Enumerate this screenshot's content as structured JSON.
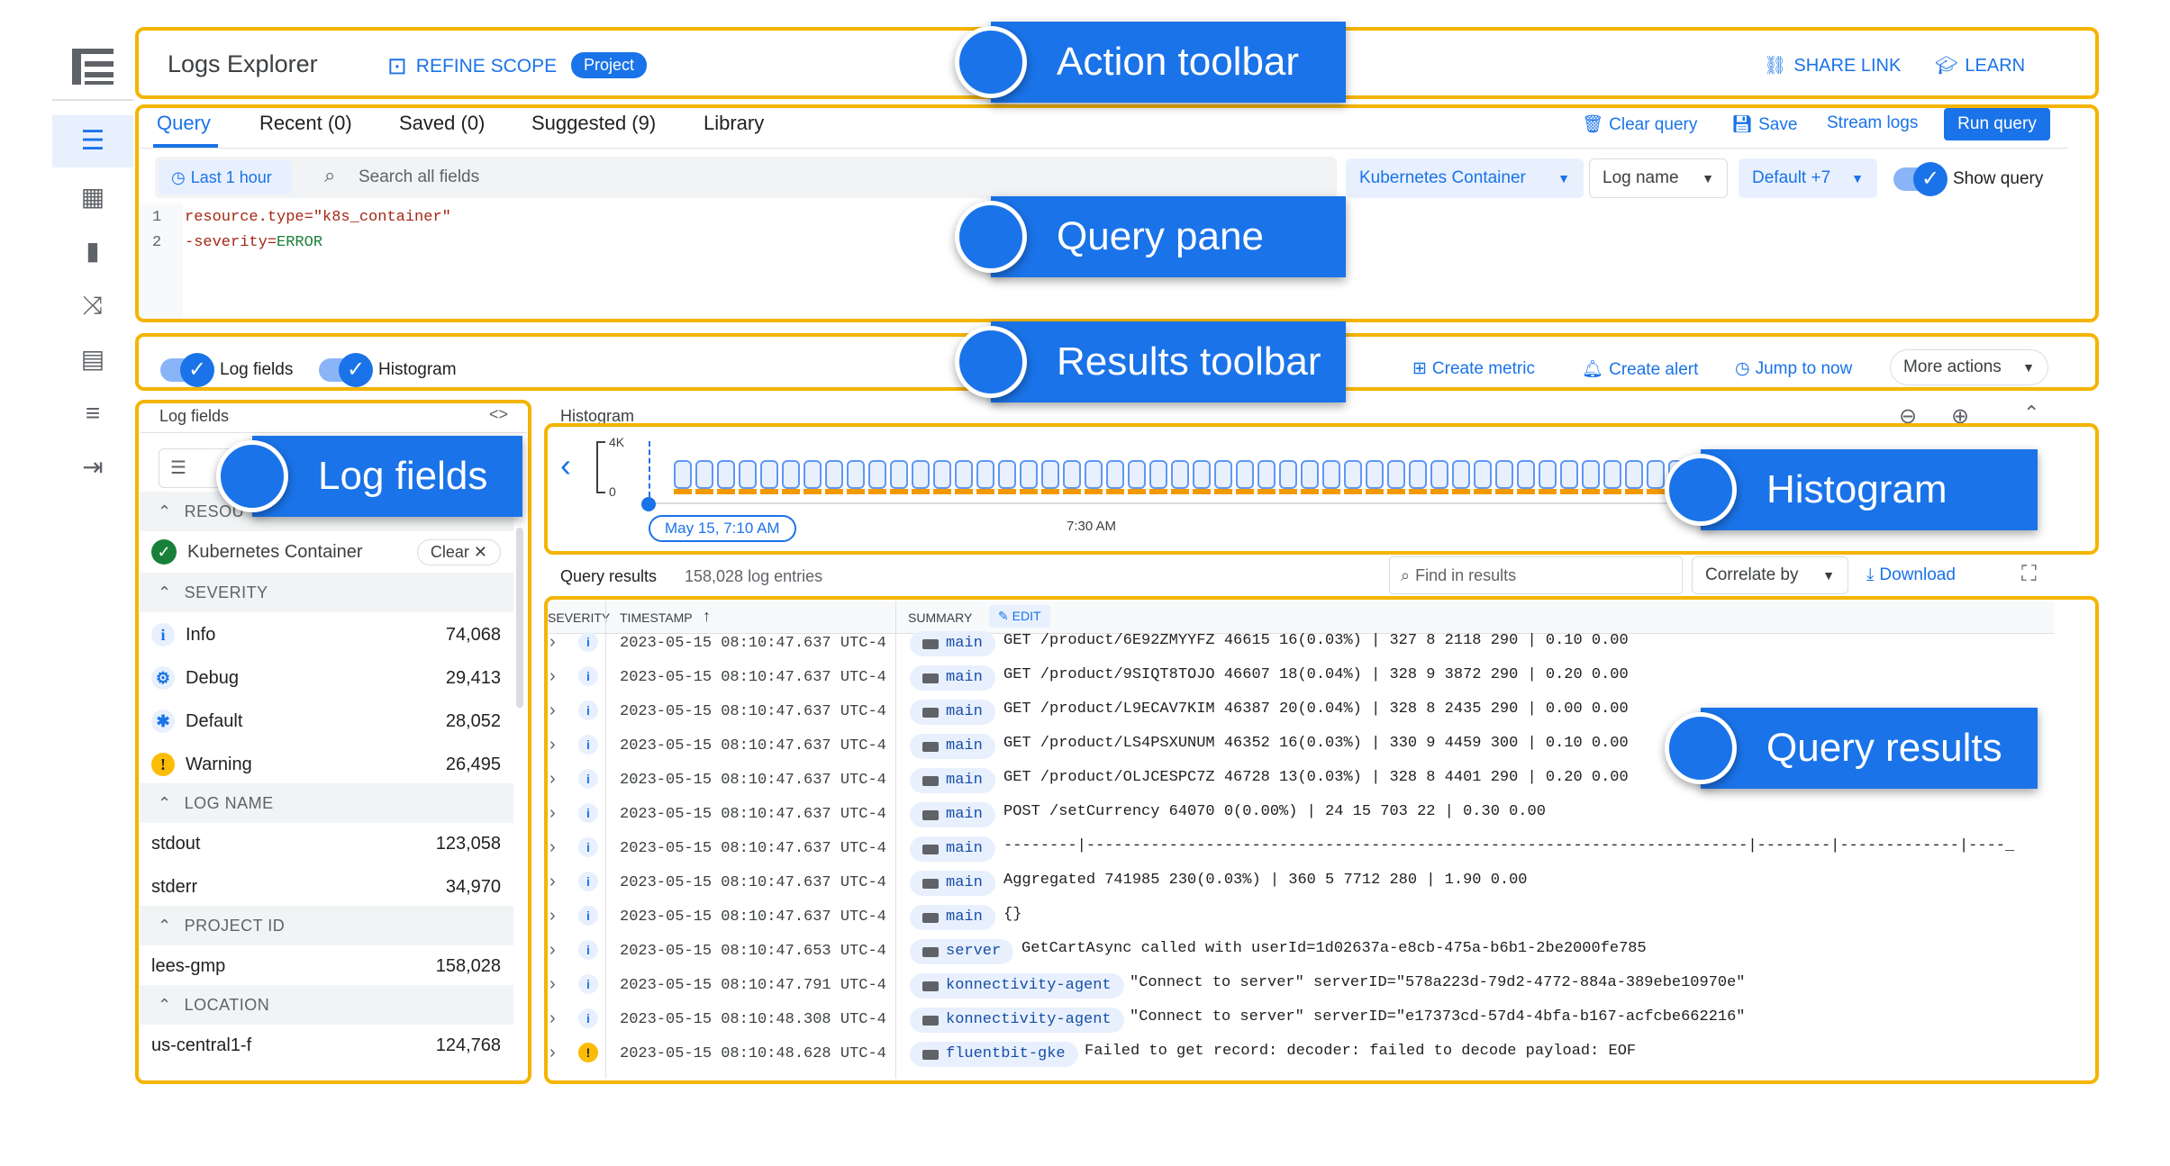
{
  "header": {
    "title": "Logs Explorer",
    "refine_scope": "REFINE SCOPE",
    "scope_badge": "Project",
    "share_link": "SHARE LINK",
    "learn": "LEARN"
  },
  "query_tabs": {
    "query": "Query",
    "recent": "Recent (0)",
    "saved": "Saved (0)",
    "suggested": "Suggested (9)",
    "library": "Library"
  },
  "query_actions": {
    "clear_query": "Clear query",
    "save": "Save",
    "stream_logs": "Stream logs",
    "run_query": "Run query"
  },
  "filters": {
    "time_range": "Last 1 hour",
    "search_placeholder": "Search all fields",
    "resource": "Kubernetes Container",
    "log_name": "Log name",
    "severity": "Default +7",
    "show_query": "Show query"
  },
  "editor": {
    "line_numbers": [
      "1",
      "2"
    ],
    "line1_key": "resource.type=",
    "line1_value": "\"k8s_container\"",
    "line2_key": "-severity=",
    "line2_value": "ERROR"
  },
  "results_toolbar": {
    "log_fields": "Log fields",
    "histogram": "Histogram",
    "create_metric": "Create metric",
    "create_alert": "Create alert",
    "jump_to_now": "Jump to now",
    "more_actions": "More actions"
  },
  "log_fields": {
    "title": "Log fields",
    "toggle_label": "<>",
    "resource_header": "RESOU",
    "resource_value": "Kubernetes Container",
    "clear": "Clear",
    "severity_header": "SEVERITY",
    "severity": [
      {
        "label": "Info",
        "count": "74,068",
        "icon": "i"
      },
      {
        "label": "Debug",
        "count": "29,413",
        "icon": "⚙"
      },
      {
        "label": "Default",
        "count": "28,052",
        "icon": "✱"
      },
      {
        "label": "Warning",
        "count": "26,495",
        "icon": "!"
      }
    ],
    "log_name_header": "LOG NAME",
    "log_names": [
      {
        "label": "stdout",
        "count": "123,058"
      },
      {
        "label": "stderr",
        "count": "34,970"
      }
    ],
    "project_header": "PROJECT ID",
    "project": {
      "label": "lees-gmp",
      "count": "158,028"
    },
    "location_header": "LOCATION",
    "location": {
      "label": "us-central1-f",
      "count": "124,768"
    }
  },
  "histogram": {
    "title": "Histogram",
    "y_max": "4K",
    "y_min": "0",
    "start_label": "May 15, 7:10 AM",
    "tick_label": "7:30 AM"
  },
  "results": {
    "title": "Query results",
    "count": "158,028 log entries",
    "find_placeholder": "Find in results",
    "correlate": "Correlate by",
    "download": "Download",
    "col_severity": "SEVERITY",
    "col_timestamp": "TIMESTAMP",
    "col_summary": "SUMMARY",
    "edit": "EDIT",
    "rows": [
      {
        "ts": "2023-05-15 08:10:47.637 UTC-4",
        "sev": "i",
        "tag": "main",
        "msg": "GET /product/6E92ZMYYFZ 46615 16(0.03%) | 327 8 2118 290 | 0.10 0.00"
      },
      {
        "ts": "2023-05-15 08:10:47.637 UTC-4",
        "sev": "i",
        "tag": "main",
        "msg": "GET /product/9SIQT8TOJO 46607 18(0.04%) | 328 9 3872 290 | 0.20 0.00"
      },
      {
        "ts": "2023-05-15 08:10:47.637 UTC-4",
        "sev": "i",
        "tag": "main",
        "msg": "GET /product/L9ECAV7KIM 46387 20(0.04%) | 328 8 2435 290 | 0.00 0.00"
      },
      {
        "ts": "2023-05-15 08:10:47.637 UTC-4",
        "sev": "i",
        "tag": "main",
        "msg": "GET /product/LS4PSXUNUM 46352 16(0.03%) | 330 9 4459 300 | 0.10 0.00"
      },
      {
        "ts": "2023-05-15 08:10:47.637 UTC-4",
        "sev": "i",
        "tag": "main",
        "msg": "GET /product/OLJCESPC7Z 46728 13(0.03%) | 328 8 4401 290 | 0.20 0.00"
      },
      {
        "ts": "2023-05-15 08:10:47.637 UTC-4",
        "sev": "i",
        "tag": "main",
        "msg": "POST /setCurrency 64070 0(0.00%) | 24 15 703 22 | 0.30 0.00"
      },
      {
        "ts": "2023-05-15 08:10:47.637 UTC-4",
        "sev": "i",
        "tag": "main",
        "msg": "--------|------------------------------------------------------------------------|--------|-------------|----_"
      },
      {
        "ts": "2023-05-15 08:10:47.637 UTC-4",
        "sev": "i",
        "tag": "main",
        "msg": " Aggregated 741985 230(0.03%) | 360 5 7712 280 | 1.90 0.00"
      },
      {
        "ts": "2023-05-15 08:10:47.637 UTC-4",
        "sev": "i",
        "tag": "main",
        "msg": "{}"
      },
      {
        "ts": "2023-05-15 08:10:47.653 UTC-4",
        "sev": "i",
        "tag": "server",
        "msg": "GetCartAsync called with userId=1d02637a-e8cb-475a-b6b1-2be2000fe785"
      },
      {
        "ts": "2023-05-15 08:10:47.791 UTC-4",
        "sev": "i",
        "tag": "konnectivity-agent",
        "msg": "\"Connect to server\" serverID=\"578a223d-79d2-4772-884a-389ebe10970e\""
      },
      {
        "ts": "2023-05-15 08:10:48.308 UTC-4",
        "sev": "i",
        "tag": "konnectivity-agent",
        "msg": "\"Connect to server\" serverID=\"e17373cd-57d4-4bfa-b167-acfcbe662216\""
      },
      {
        "ts": "2023-05-15 08:10:48.628 UTC-4",
        "sev": "!",
        "tag": "fluentbit-gke",
        "msg": "Failed to get record: decoder: failed to decode payload: EOF"
      }
    ]
  },
  "callouts": {
    "action_toolbar": "Action toolbar",
    "query_pane": "Query pane",
    "results_toolbar": "Results toolbar",
    "log_fields": "Log fields",
    "histogram": "Histogram",
    "query_results": "Query results"
  },
  "colors": {
    "accent": "#1a73e8",
    "outline": "#f4b400",
    "warning": "#fbbc04",
    "success": "#188038",
    "histogram_bar": "#f29900"
  }
}
